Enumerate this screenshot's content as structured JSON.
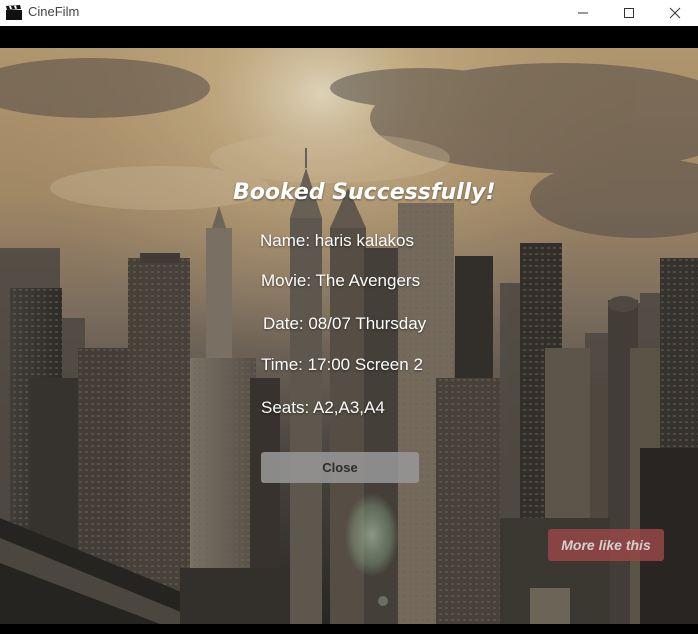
{
  "window": {
    "title": "CineFilm",
    "icons": {
      "app": "clapperboard-icon",
      "minimize": "minimize-icon",
      "maximize": "maximize-icon",
      "close": "close-icon"
    }
  },
  "booking": {
    "heading": "Booked Successfully!",
    "name": "Name: haris kalakos",
    "movie": "Movie: The Avengers",
    "date": "Date: 08/07 Thursday",
    "time": "Time: 17:00 Screen 2",
    "seats": "Seats: A2,A3,A4",
    "close_label": "Close"
  },
  "more_like_this_label": "More like this",
  "colors": {
    "close_button": "#969696",
    "more_button": "#964646",
    "text": "#ffffff"
  }
}
